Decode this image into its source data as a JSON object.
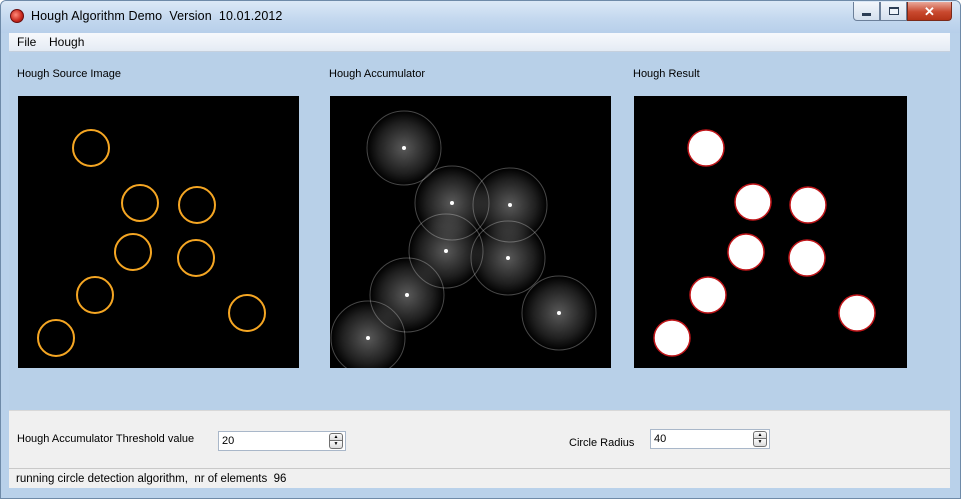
{
  "window": {
    "title": "Hough Algorithm Demo  Version  10.01.2012",
    "controls": {
      "minimize": "minimize-icon",
      "maximize": "maximize-icon",
      "close": "close-icon"
    }
  },
  "menu": [
    {
      "label": "File"
    },
    {
      "label": "Hough"
    }
  ],
  "panels": {
    "source": {
      "label": "Hough Source Image"
    },
    "accumulator": {
      "label": "Hough Accumulator"
    },
    "result": {
      "label": "Hough Result"
    }
  },
  "controls": {
    "threshold": {
      "label": "Hough Accumulator Threshold value",
      "value": "20"
    },
    "radius": {
      "label": "Circle Radius",
      "value": "40"
    }
  },
  "status": {
    "text": "running circle detection algorithm,  nr of elements  96"
  },
  "colors": {
    "window_bg": "#b9d1ea",
    "source_circle": "#f5a623",
    "result_fill": "#ffffff",
    "result_edge": "#c0161a",
    "accumulator_glow": "#ffffff"
  }
}
